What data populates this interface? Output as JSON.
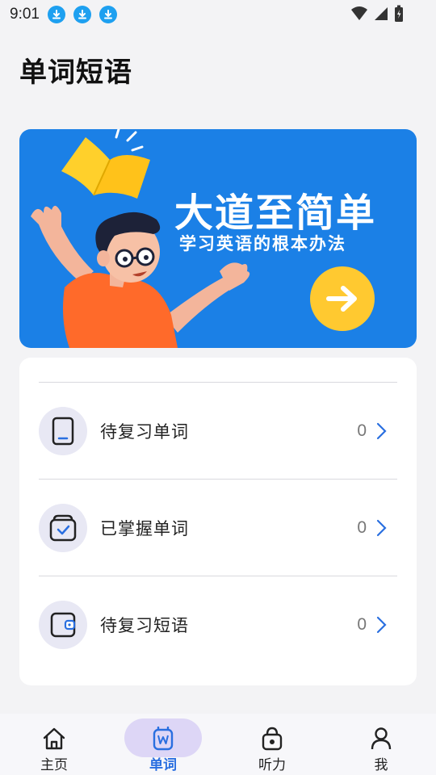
{
  "status_bar": {
    "time": "9:01",
    "icons": [
      "download-icon",
      "download-icon",
      "download-icon",
      "wifi-icon",
      "signal-icon",
      "battery-icon"
    ]
  },
  "header": {
    "title": "单词短语"
  },
  "banner": {
    "title": "大道至简单",
    "subtitle": "学习英语的根本办法",
    "colors": {
      "background": "#1b80e6",
      "button": "#ffc930"
    }
  },
  "list": {
    "items": [
      {
        "label": "待复习单词",
        "count": "0",
        "icon": "tablet-icon"
      },
      {
        "label": "已掌握单词",
        "count": "0",
        "icon": "checked-box-icon"
      },
      {
        "label": "待复习短语",
        "count": "0",
        "icon": "wallet-icon"
      }
    ]
  },
  "nav": {
    "items": [
      {
        "label": "主页",
        "icon": "home-icon"
      },
      {
        "label": "单词",
        "icon": "word-icon",
        "active": true
      },
      {
        "label": "听力",
        "icon": "listen-icon"
      },
      {
        "label": "我",
        "icon": "user-icon"
      }
    ],
    "accent": "#2a6fe0"
  }
}
